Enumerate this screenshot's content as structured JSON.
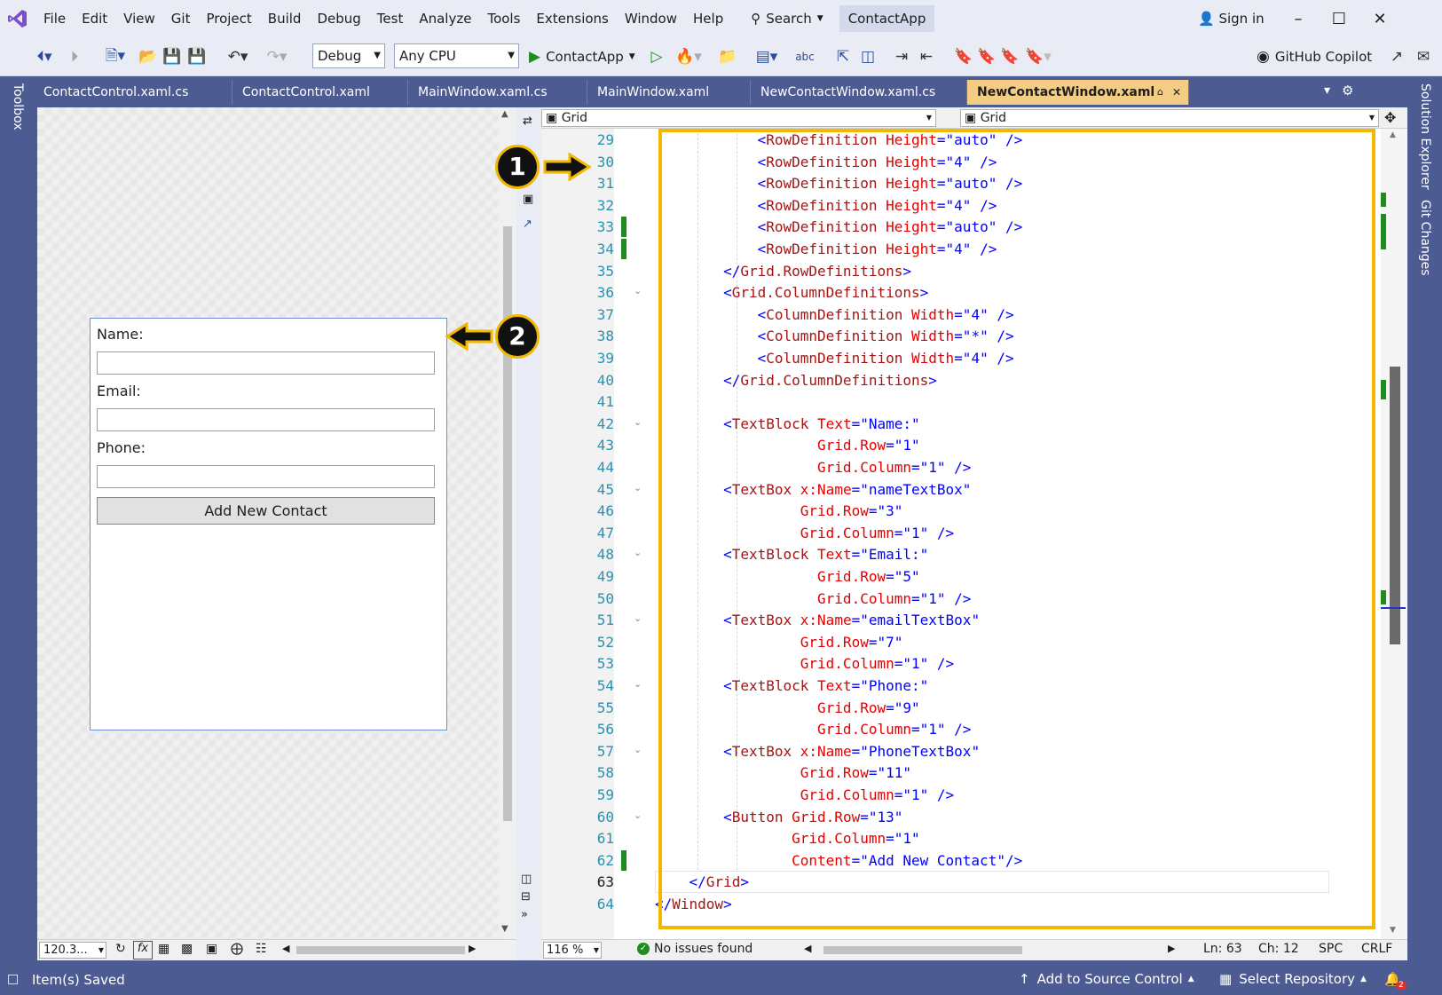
{
  "menubar": {
    "items": [
      "File",
      "Edit",
      "View",
      "Git",
      "Project",
      "Build",
      "Debug",
      "Test",
      "Analyze",
      "Tools",
      "Extensions",
      "Window",
      "Help"
    ],
    "search_label": "Search",
    "project_name": "ContactApp",
    "sign_in": "Sign in"
  },
  "toolbar": {
    "config": "Debug",
    "platform": "Any CPU",
    "run_target": "ContactApp",
    "copilot": "GitHub Copilot"
  },
  "tabs": [
    {
      "label": "ContactControl.xaml.cs"
    },
    {
      "label": "ContactControl.xaml"
    },
    {
      "label": "MainWindow.xaml.cs"
    },
    {
      "label": "MainWindow.xaml"
    },
    {
      "label": "NewContactWindow.xaml.cs"
    },
    {
      "label": "NewContactWindow.xaml",
      "active": true
    }
  ],
  "side_panels": {
    "left": "Toolbox",
    "right1": "Solution Explorer",
    "right2": "Git Changes"
  },
  "designer": {
    "name_label": "Name:",
    "email_label": "Email:",
    "phone_label": "Phone:",
    "button_label": "Add New Contact",
    "zoom": "120.3...",
    "fx": "fx"
  },
  "editor": {
    "nav_left": "Grid",
    "nav_right": "Grid",
    "zoom": "116 %",
    "issues": "No issues found",
    "line": "Ln: 63",
    "col": "Ch: 12",
    "spc": "SPC",
    "eol": "CRLF",
    "current_line": 63,
    "lines": [
      {
        "n": 29,
        "html": "            <span class='p'>&lt;</span><span class='t'>RowDefinition</span> <span class='a'>Height</span><span class='p'>=\"auto\" /&gt;</span>"
      },
      {
        "n": 30,
        "html": "            <span class='p'>&lt;</span><span class='t'>RowDefinition</span> <span class='a'>Height</span><span class='p'>=\"4\" /&gt;</span>"
      },
      {
        "n": 31,
        "html": "            <span class='p'>&lt;</span><span class='t'>RowDefinition</span> <span class='a'>Height</span><span class='p'>=\"auto\" /&gt;</span>"
      },
      {
        "n": 32,
        "html": "            <span class='p'>&lt;</span><span class='t'>RowDefinition</span> <span class='a'>Height</span><span class='p'>=\"4\" /&gt;</span>"
      },
      {
        "n": 33,
        "html": "            <span class='p'>&lt;</span><span class='t'>RowDefinition</span> <span class='a'>Height</span><span class='p'>=\"auto\" /&gt;</span>"
      },
      {
        "n": 34,
        "html": "            <span class='p'>&lt;</span><span class='t'>RowDefinition</span> <span class='a'>Height</span><span class='p'>=\"4\" /&gt;</span>"
      },
      {
        "n": 35,
        "html": "        <span class='p'>&lt;/</span><span class='t'>Grid.RowDefinitions</span><span class='p'>&gt;</span>"
      },
      {
        "n": 36,
        "html": "        <span class='p'>&lt;</span><span class='t'>Grid.ColumnDefinitions</span><span class='p'>&gt;</span>"
      },
      {
        "n": 37,
        "html": "            <span class='p'>&lt;</span><span class='t'>ColumnDefinition</span> <span class='a'>Width</span><span class='p'>=\"4\" /&gt;</span>"
      },
      {
        "n": 38,
        "html": "            <span class='p'>&lt;</span><span class='t'>ColumnDefinition</span> <span class='a'>Width</span><span class='p'>=\"*\" /&gt;</span>"
      },
      {
        "n": 39,
        "html": "            <span class='p'>&lt;</span><span class='t'>ColumnDefinition</span> <span class='a'>Width</span><span class='p'>=\"4\" /&gt;</span>"
      },
      {
        "n": 40,
        "html": "        <span class='p'>&lt;/</span><span class='t'>Grid.ColumnDefinitions</span><span class='p'>&gt;</span>"
      },
      {
        "n": 41,
        "html": ""
      },
      {
        "n": 42,
        "html": "        <span class='p'>&lt;</span><span class='t'>TextBlock</span> <span class='a'>Text</span><span class='p'>=\"Name:\"</span>"
      },
      {
        "n": 43,
        "html": "                   <span class='a'>Grid.Row</span><span class='p'>=\"1\"</span>"
      },
      {
        "n": 44,
        "html": "                   <span class='a'>Grid.Column</span><span class='p'>=\"1\" /&gt;</span>"
      },
      {
        "n": 45,
        "html": "        <span class='p'>&lt;</span><span class='t'>TextBox</span> <span class='a'>x:Name</span><span class='p'>=\"nameTextBox\"</span>"
      },
      {
        "n": 46,
        "html": "                 <span class='a'>Grid.Row</span><span class='p'>=\"3\"</span>"
      },
      {
        "n": 47,
        "html": "                 <span class='a'>Grid.Column</span><span class='p'>=\"1\" /&gt;</span>"
      },
      {
        "n": 48,
        "html": "        <span class='p'>&lt;</span><span class='t'>TextBlock</span> <span class='a'>Text</span><span class='p'>=\"Email:\"</span>"
      },
      {
        "n": 49,
        "html": "                   <span class='a'>Grid.Row</span><span class='p'>=\"5\"</span>"
      },
      {
        "n": 50,
        "html": "                   <span class='a'>Grid.Column</span><span class='p'>=\"1\" /&gt;</span>"
      },
      {
        "n": 51,
        "html": "        <span class='p'>&lt;</span><span class='t'>TextBox</span> <span class='a'>x:Name</span><span class='p'>=\"emailTextBox\"</span>"
      },
      {
        "n": 52,
        "html": "                 <span class='a'>Grid.Row</span><span class='p'>=\"7\"</span>"
      },
      {
        "n": 53,
        "html": "                 <span class='a'>Grid.Column</span><span class='p'>=\"1\" /&gt;</span>"
      },
      {
        "n": 54,
        "html": "        <span class='p'>&lt;</span><span class='t'>TextBlock</span> <span class='a'>Text</span><span class='p'>=\"Phone:\"</span>"
      },
      {
        "n": 55,
        "html": "                   <span class='a'>Grid.Row</span><span class='p'>=\"9\"</span>"
      },
      {
        "n": 56,
        "html": "                   <span class='a'>Grid.Column</span><span class='p'>=\"1\" /&gt;</span>"
      },
      {
        "n": 57,
        "html": "        <span class='p'>&lt;</span><span class='t'>TextBox</span> <span class='a'>x:Name</span><span class='p'>=\"PhoneTextBox\"</span>"
      },
      {
        "n": 58,
        "html": "                 <span class='a'>Grid.Row</span><span class='p'>=\"11\"</span>"
      },
      {
        "n": 59,
        "html": "                 <span class='a'>Grid.Column</span><span class='p'>=\"1\" /&gt;</span>"
      },
      {
        "n": 60,
        "html": "        <span class='p'>&lt;</span><span class='t'>Button</span> <span class='a'>Grid.Row</span><span class='p'>=\"13\"</span>"
      },
      {
        "n": 61,
        "html": "                <span class='a'>Grid.Column</span><span class='p'>=\"1\"</span>"
      },
      {
        "n": 62,
        "html": "                <span class='a'>Content</span><span class='p'>=\"Add New Contact\"/&gt;</span>"
      },
      {
        "n": 63,
        "html": "    <span class='p'>&lt;/</span><span class='t'>Grid</span><span class='p'>&gt;</span>"
      },
      {
        "n": 64,
        "html": "<span class='p'>&lt;/</span><span class='t'>Window</span><span class='p'>&gt;</span>"
      }
    ]
  },
  "statusbar": {
    "left": "Item(s) Saved",
    "source_control": "Add to Source Control",
    "repository": "Select Repository",
    "notifications": "2"
  },
  "callouts": [
    "1",
    "2"
  ],
  "colors": {
    "accent": "#4d5b93",
    "highlight": "#f2b800",
    "active_tab": "#f5cc84"
  }
}
